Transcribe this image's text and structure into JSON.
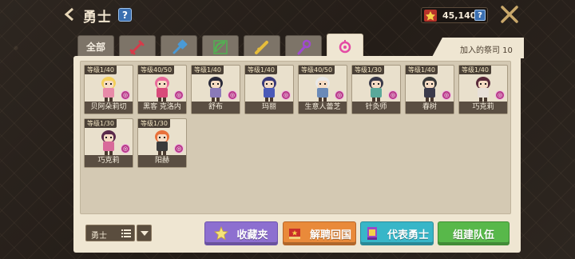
{
  "header": {
    "title": "勇士",
    "help": "?",
    "currency_amount": "45,140",
    "currency_help": "?"
  },
  "tabs": [
    {
      "label": "全部",
      "icon": "all"
    },
    {
      "label": "",
      "icon": "sword-icon",
      "color": "#c9384a"
    },
    {
      "label": "",
      "icon": "hammer-icon",
      "color": "#3f8fc8"
    },
    {
      "label": "",
      "icon": "bow-icon",
      "color": "#4aa84a"
    },
    {
      "label": "",
      "icon": "gun-icon",
      "color": "#e0b93a"
    },
    {
      "label": "",
      "icon": "staff-icon",
      "color": "#9a4ac8"
    },
    {
      "label": "",
      "icon": "pink-orb-icon",
      "color": "#e44aa4",
      "active": true
    }
  ],
  "recruit_label": "加入的祭司 10",
  "heroes": [
    {
      "level": "等级1/40",
      "name": "贝阿朵莉切",
      "hair": "#f4cf5a",
      "outfit": "#e88aa8"
    },
    {
      "level": "等级40/50",
      "name": "黑客 克洛内",
      "hair": "#e86a9a",
      "outfit": "#d84a7a"
    },
    {
      "level": "等级1/40",
      "name": "舒布",
      "hair": "#2a2a3a",
      "outfit": "#8a7ab8"
    },
    {
      "level": "等级1/40",
      "name": "玛丽",
      "hair": "#3a3a7a",
      "outfit": "#4a5ab8"
    },
    {
      "level": "等级40/50",
      "name": "生意人蕾芝",
      "hair": "#e8e8e8",
      "outfit": "#6a8ab8"
    },
    {
      "level": "等级1/30",
      "name": "针灸师",
      "hair": "#3a3a4a",
      "outfit": "#5aa89a"
    },
    {
      "level": "等级1/40",
      "name": "春树",
      "hair": "#3a3a3a",
      "outfit": "#3a3a4a"
    },
    {
      "level": "等级1/40",
      "name": "巧克莉",
      "hair": "#5a2a3a",
      "outfit": "#e8e0d8"
    },
    {
      "level": "等级1/30",
      "name": "巧克莉",
      "hair": "#5a2a4a",
      "outfit": "#d86a9a"
    },
    {
      "level": "等级1/30",
      "name": "阳赫",
      "hair": "#e8703a",
      "outfit": "#3a3a3a"
    }
  ],
  "hero_badge": "◎",
  "sort": {
    "label": "勇士"
  },
  "buttons": {
    "favorites": "收藏夹",
    "dismiss": "解聘回国",
    "representative": "代表勇士",
    "team": "组建队伍"
  }
}
